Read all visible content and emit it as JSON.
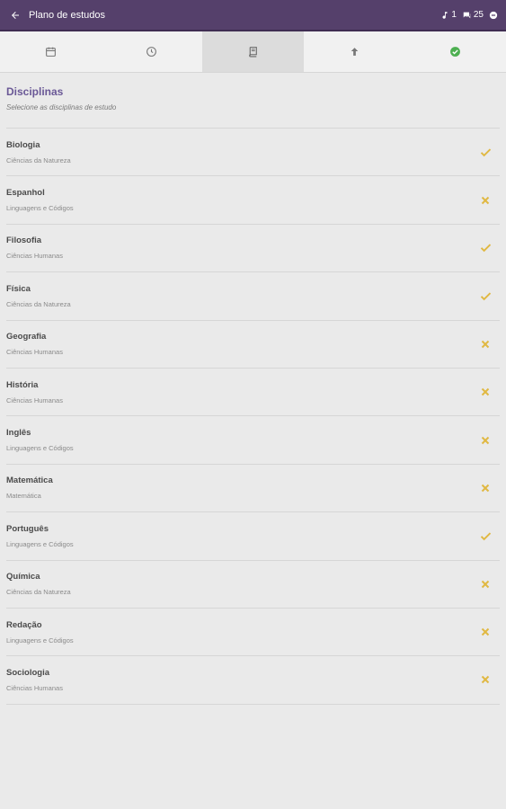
{
  "appbar": {
    "title": "Plano de estudos",
    "stats": [
      {
        "icon": "music-note-icon",
        "value": "1"
      },
      {
        "icon": "chat-icon",
        "value": "25"
      }
    ]
  },
  "tabs": [
    {
      "icon": "calendar-icon",
      "active": false
    },
    {
      "icon": "clock-icon",
      "active": false
    },
    {
      "icon": "book-icon",
      "active": true
    },
    {
      "icon": "arrow-up-icon",
      "active": false
    },
    {
      "icon": "check-circle-icon",
      "active": false,
      "color": "#4caf50"
    }
  ],
  "section": {
    "title": "Disciplinas",
    "subtitle": "Selecione as disciplinas de estudo"
  },
  "colors": {
    "appbar": "#55406b",
    "accent": "#6a5896",
    "status": "#e0b842",
    "success": "#4caf50"
  },
  "subjects": [
    {
      "name": "Biologia",
      "area": "Ciências da Natureza",
      "selected": true
    },
    {
      "name": "Espanhol",
      "area": "Linguagens e Códigos",
      "selected": false
    },
    {
      "name": "Filosofia",
      "area": "Ciências Humanas",
      "selected": true
    },
    {
      "name": "Física",
      "area": "Ciências da Natureza",
      "selected": true
    },
    {
      "name": "Geografia",
      "area": "Ciências Humanas",
      "selected": false
    },
    {
      "name": "História",
      "area": "Ciências Humanas",
      "selected": false
    },
    {
      "name": "Inglês",
      "area": "Linguagens e Códigos",
      "selected": false
    },
    {
      "name": "Matemática",
      "area": "Matemática",
      "selected": false
    },
    {
      "name": "Português",
      "area": "Linguagens e Códigos",
      "selected": true
    },
    {
      "name": "Química",
      "area": "Ciências da Natureza",
      "selected": false
    },
    {
      "name": "Redação",
      "area": "Linguagens e Códigos",
      "selected": false
    },
    {
      "name": "Sociologia",
      "area": "Ciências Humanas",
      "selected": false
    }
  ]
}
